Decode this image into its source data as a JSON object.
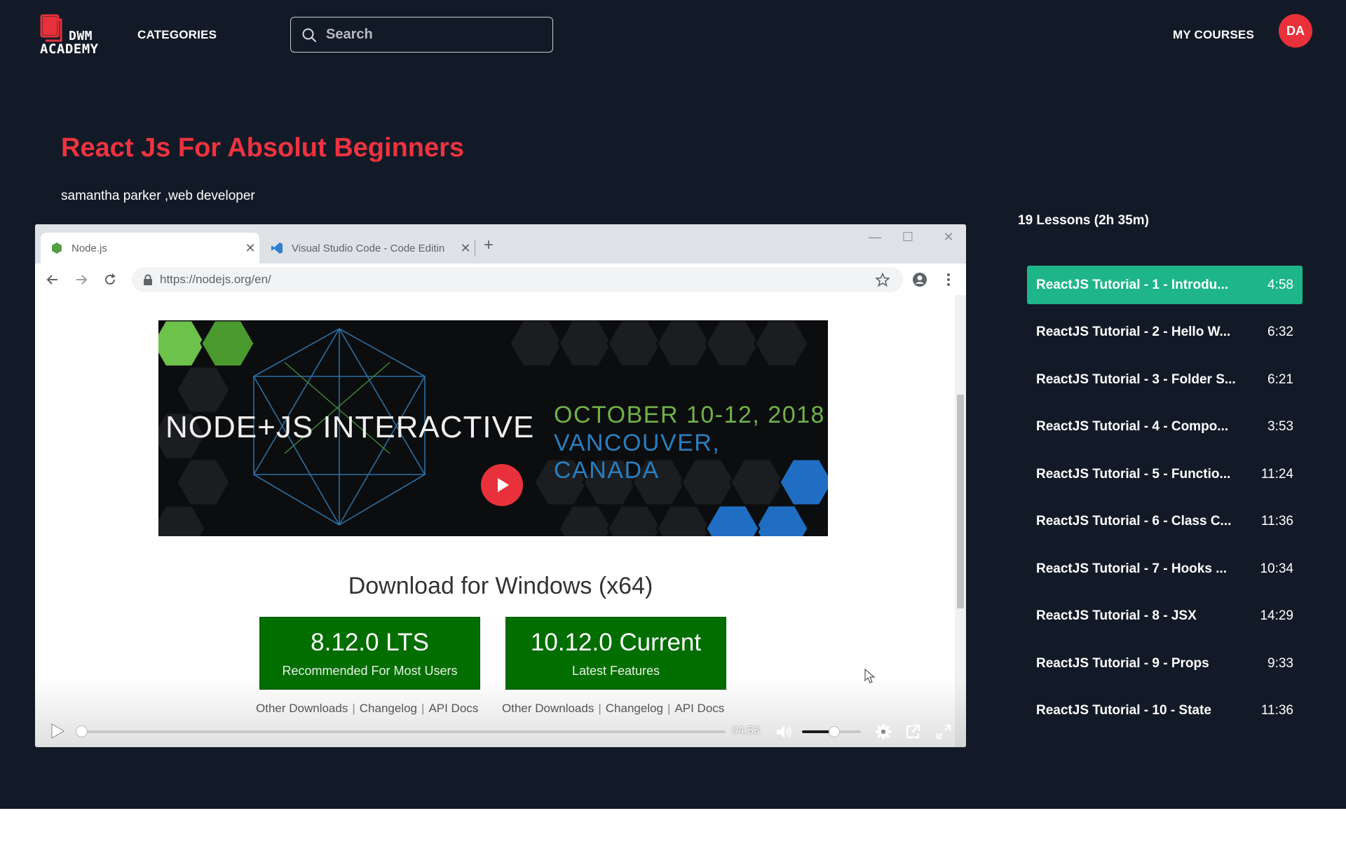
{
  "brand": {
    "line1": "DWM",
    "line2": "ACADEMY"
  },
  "nav": {
    "categories": "CATEGORIES",
    "my_courses": "MY COURSES"
  },
  "search": {
    "placeholder": "Search",
    "value": ""
  },
  "user": {
    "initials": "DA"
  },
  "course": {
    "title": "React Js For Absolut Beginners",
    "author": "samantha parker ,web developer"
  },
  "video": {
    "browser": {
      "tabs": [
        {
          "label": "Node.js"
        },
        {
          "label": "Visual Studio Code - Code Editin"
        }
      ],
      "url": "https://nodejs.org/en/"
    },
    "banner": {
      "title": "NODE+JS INTERACTIVE",
      "date": "OCTOBER 10-12, 2018",
      "place": "VANCOUVER, CANADA"
    },
    "download": {
      "heading": "Download for Windows (x64)",
      "lts": {
        "version": "8.12.0 LTS",
        "subtitle": "Recommended For Most Users"
      },
      "current": {
        "version": "10.12.0 Current",
        "subtitle": "Latest Features"
      },
      "links": [
        "Other Downloads",
        "Changelog",
        "API Docs"
      ]
    },
    "player": {
      "time": "04:53",
      "progress": 0.0,
      "volume": 0.55
    }
  },
  "lessons_summary": "19 Lessons (2h 35m)",
  "lessons": [
    {
      "title": "ReactJS Tutorial - 1 - Introdu...",
      "duration": "4:58",
      "active": true
    },
    {
      "title": "ReactJS Tutorial - 2 - Hello W...",
      "duration": "6:32",
      "active": false
    },
    {
      "title": "ReactJS Tutorial - 3 - Folder S...",
      "duration": "6:21",
      "active": false
    },
    {
      "title": "ReactJS Tutorial - 4 - Compo...",
      "duration": "3:53",
      "active": false
    },
    {
      "title": "ReactJS Tutorial - 5 - Functio...",
      "duration": "11:24",
      "active": false
    },
    {
      "title": "ReactJS Tutorial - 6 - Class C...",
      "duration": "11:36",
      "active": false
    },
    {
      "title": "ReactJS Tutorial - 7 - Hooks ...",
      "duration": "10:34",
      "active": false
    },
    {
      "title": "ReactJS Tutorial - 8 - JSX",
      "duration": "14:29",
      "active": false
    },
    {
      "title": "ReactJS Tutorial - 9 - Props",
      "duration": "9:33",
      "active": false
    },
    {
      "title": "ReactJS Tutorial - 10 - State",
      "duration": "11:36",
      "active": false
    }
  ],
  "icons": {
    "logo": "book-logo-icon",
    "search": "search-icon",
    "play": "play-icon",
    "volume": "volume-icon",
    "settings": "gear-icon",
    "popout": "external-link-icon",
    "fullscreen": "fullscreen-icon"
  },
  "colors": {
    "background": "#131a27",
    "accent_red": "#ee3340",
    "active_lesson": "#1eb589",
    "download_green": "#026e00"
  }
}
